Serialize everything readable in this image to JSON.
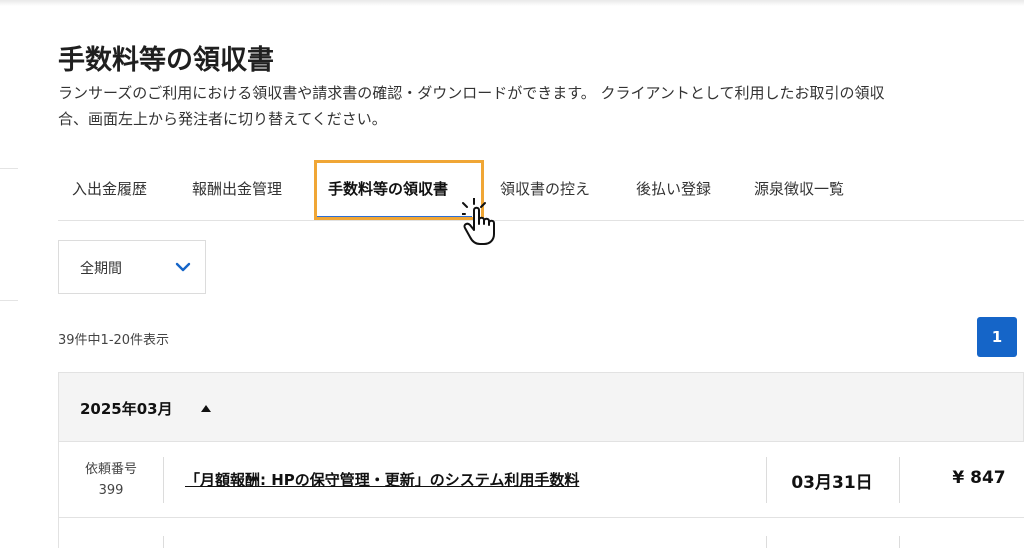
{
  "page": {
    "title": "手数料等の領収書",
    "description_line1": "ランサーズのご利用における領収書や請求書の確認・ダウンロードができます。 クライアントとして利用したお取引の領収",
    "description_line2": "合、画面左上から発注者に切り替えてください。"
  },
  "tabs": [
    {
      "label": "入出金履歴",
      "active": false
    },
    {
      "label": "報酬出金管理",
      "active": false
    },
    {
      "label": "手数料等の領収書",
      "active": true
    },
    {
      "label": "領収書の控え",
      "active": false
    },
    {
      "label": "後払い登録",
      "active": false
    },
    {
      "label": "源泉徴収一覧",
      "active": false
    }
  ],
  "filter": {
    "period_label": "全期間",
    "icon": "chevron-down-icon"
  },
  "results": {
    "count_text": "39件中1-20件表示",
    "current_page": "1"
  },
  "month_group": {
    "label": "2025年03月",
    "icon": "caret-up-icon",
    "expanded": true
  },
  "rows": [
    {
      "request_label": "依頼番号",
      "request_number": "399",
      "title": "「月額報酬: HPの保守管理・更新」のシステム利用手数料",
      "date": "03月31日",
      "amount": "¥ 847"
    }
  ],
  "colors": {
    "accent_blue": "#1565c8",
    "tab_underline": "#2b6fd6",
    "highlight_orange": "#f0a635",
    "header_bg": "#f4f4f4"
  }
}
